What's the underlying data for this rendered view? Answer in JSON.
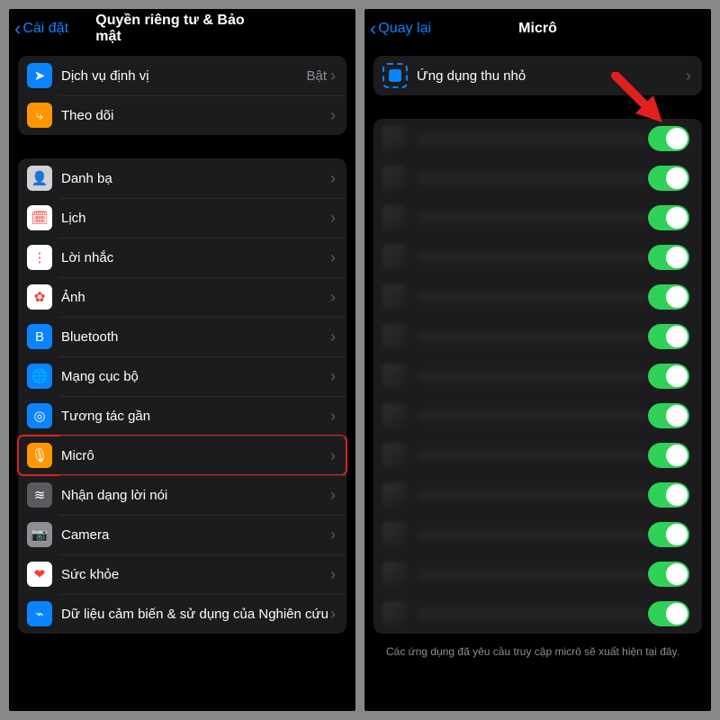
{
  "left": {
    "back": "Cài đặt",
    "title": "Quyền riêng tư & Bảo mật",
    "group1": [
      {
        "label": "Dịch vụ định vị",
        "value": "Bật",
        "icon": "location-icon",
        "bg": "#0a84ff",
        "glyph": "➤"
      },
      {
        "label": "Theo dõi",
        "icon": "tracking-icon",
        "bg": "#ff9500",
        "glyph": "⤷"
      }
    ],
    "group2": [
      {
        "label": "Danh bạ",
        "icon": "contacts-icon",
        "bg": "#d1d1d6",
        "glyph": "👤"
      },
      {
        "label": "Lịch",
        "icon": "calendar-icon",
        "bg": "#ffffff",
        "glyph": "🗓"
      },
      {
        "label": "Lời nhắc",
        "icon": "reminders-icon",
        "bg": "#ffffff",
        "glyph": "⋮"
      },
      {
        "label": "Ảnh",
        "icon": "photos-icon",
        "bg": "#ffffff",
        "glyph": "✿"
      },
      {
        "label": "Bluetooth",
        "icon": "bluetooth-icon",
        "bg": "#0a84ff",
        "glyph": "B"
      },
      {
        "label": "Mạng cục bộ",
        "icon": "local-network-icon",
        "bg": "#0a84ff",
        "glyph": "🌐"
      },
      {
        "label": "Tương tác gần",
        "icon": "nearby-icon",
        "bg": "#0a84ff",
        "glyph": "◎"
      },
      {
        "label": "Micrô",
        "icon": "microphone-icon",
        "bg": "#ff9500",
        "glyph": "🎙",
        "highlight": true
      },
      {
        "label": "Nhận dạng lời nói",
        "icon": "speech-icon",
        "bg": "#5a5a5e",
        "glyph": "≋"
      },
      {
        "label": "Camera",
        "icon": "camera-icon",
        "bg": "#8e8e93",
        "glyph": "📷"
      },
      {
        "label": "Sức khỏe",
        "icon": "health-icon",
        "bg": "#ffffff",
        "glyph": "❤"
      },
      {
        "label": "Dữ liệu cảm biến & sử dụng của Nghiên cứu",
        "icon": "research-icon",
        "bg": "#0a84ff",
        "glyph": "⌁"
      }
    ]
  },
  "right": {
    "back": "Quay lại",
    "title": "Micrô",
    "pip_label": "Ứng dụng thu nhỏ",
    "footer": "Các ứng dụng đã yêu cầu truy cập micrô sẽ xuất hiện tại đây.",
    "toggle_count": 13
  }
}
